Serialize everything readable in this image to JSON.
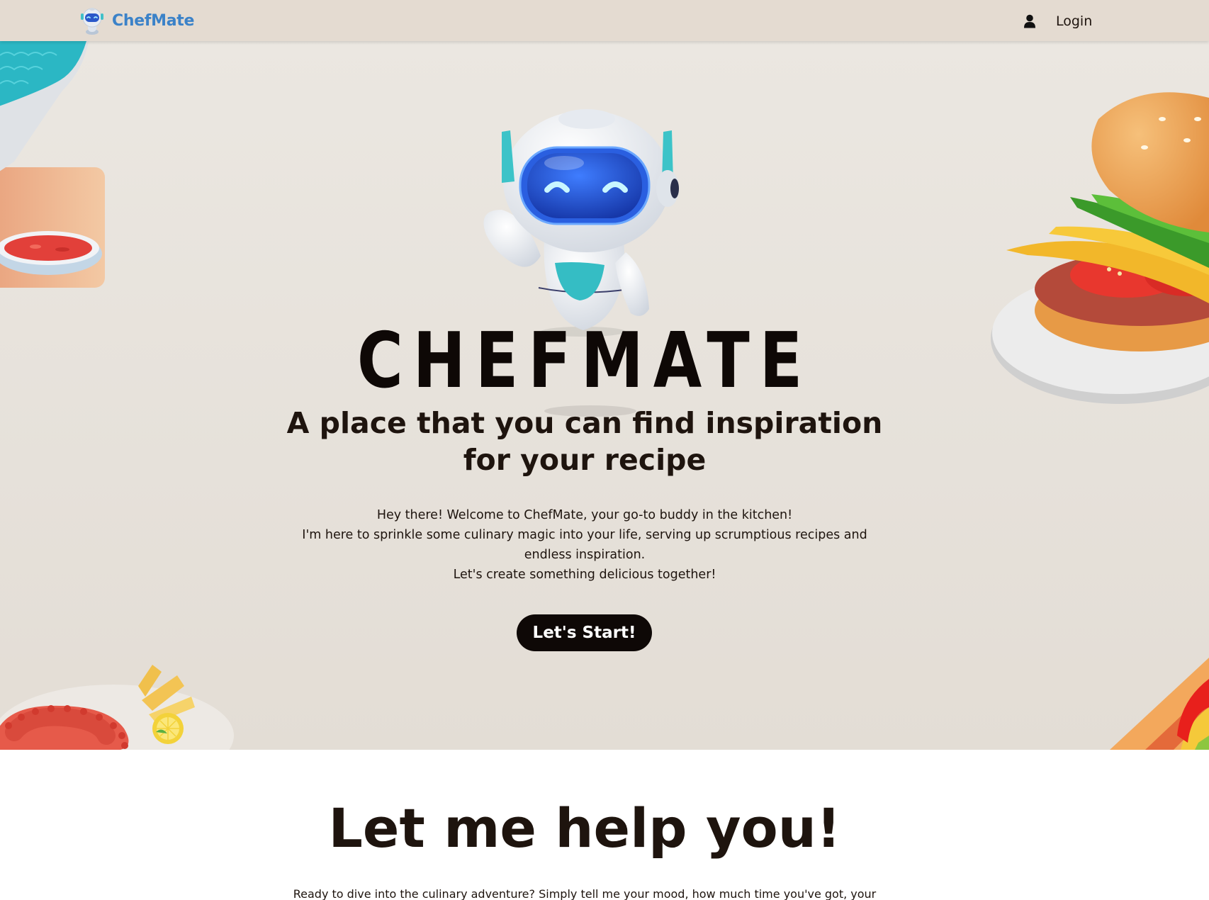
{
  "nav": {
    "brand_name": "ChefMate",
    "login_label": "Login",
    "logo_icon": "robot-logo-icon",
    "user_icon": "user-icon"
  },
  "hero": {
    "big_title": "CHEFMATE",
    "tagline_line1": "A place that you can find inspiration",
    "tagline_line2": "for your recipe",
    "intro_line1": "Hey there! Welcome to ChefMate, your go-to buddy in the kitchen!",
    "intro_line2": "I'm here to sprinkle some culinary magic into your life, serving up scrumptious recipes and endless inspiration.",
    "intro_line3": "Let's create something delicious together!",
    "start_button": "Let's Start!",
    "mascot_icon": "robot-mascot-icon",
    "decorations": [
      "noodle-bowl-icon",
      "burger-icon",
      "octopus-plate-icon",
      "hot-dog-icon"
    ]
  },
  "help_section": {
    "title": "Let me help you!",
    "text": "Ready to dive into the culinary adventure? Simply tell me your mood, how much time you've got, your"
  },
  "colors": {
    "nav_bg": "#e4dbd1",
    "hero_bg": "#e8e3dc",
    "brand_blue": "#3b82c8",
    "text_dark": "#1e140e",
    "button_bg": "#0e0806"
  }
}
